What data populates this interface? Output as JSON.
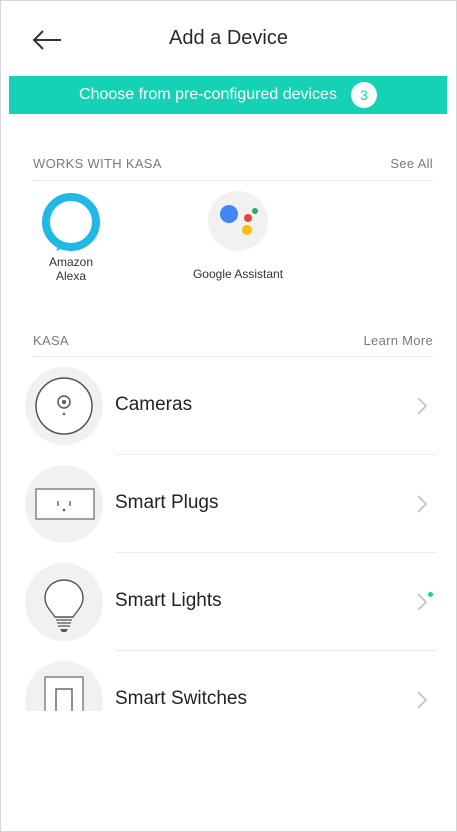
{
  "header": {
    "title": "Add a Device",
    "back_icon": "arrow-left-icon"
  },
  "banner": {
    "text": "Choose from pre-configured devices",
    "count": "3",
    "color": "#16d2b5"
  },
  "works_with": {
    "heading": "WORKS WITH KASA",
    "see_all": "See All",
    "partners": [
      {
        "name_line1": "Amazon",
        "name_line2": "Alexa",
        "icon": "alexa-icon"
      },
      {
        "name": "Google Assistant",
        "icon": "google-assistant-icon"
      }
    ]
  },
  "kasa": {
    "heading": "KASA",
    "learn_more": "Learn More",
    "items": [
      {
        "label": "Cameras",
        "icon": "camera-icon"
      },
      {
        "label": "Smart Plugs",
        "icon": "plug-icon"
      },
      {
        "label": "Smart Lights",
        "icon": "bulb-icon"
      },
      {
        "label": "Smart Switches",
        "icon": "switch-icon"
      }
    ]
  }
}
